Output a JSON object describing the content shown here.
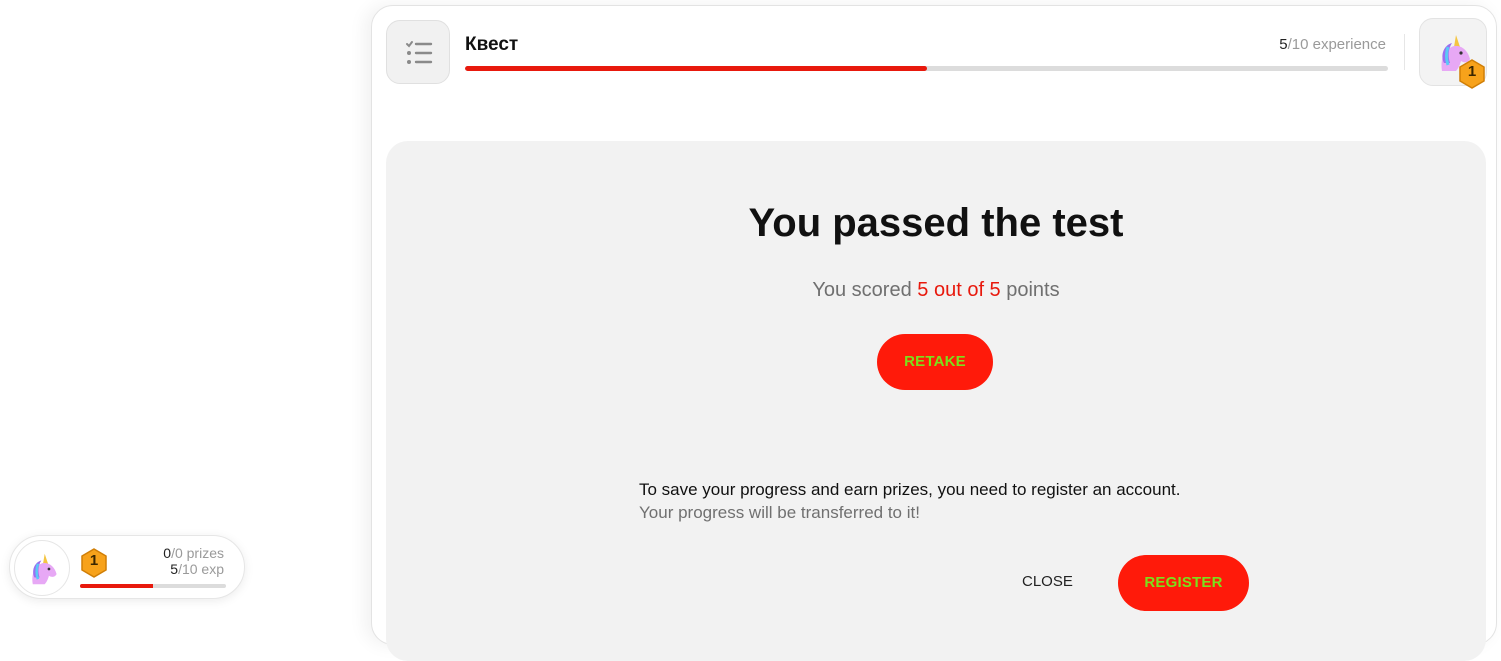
{
  "quest": {
    "title": "Квест",
    "exp_current": "5",
    "exp_total": "/10 experience",
    "progress_fraction": 0.5,
    "level": "1"
  },
  "result": {
    "title": "You passed the test",
    "score_prefix": "You scored ",
    "score_value": "5 out of 5",
    "score_suffix": " points",
    "retake_label": "RETAKE"
  },
  "register_prompt": {
    "message": "To save your progress and earn prizes, you need to register an account.",
    "sub": "Your progress will be transferred to it!",
    "close_label": "CLOSE",
    "register_label": "REGISTER"
  },
  "mini_widget": {
    "level": "1",
    "prizes_current": "0",
    "prizes_total": "/0 prizes",
    "exp_current": "5",
    "exp_total": "/10 exp",
    "progress_fraction": 0.5
  },
  "colors": {
    "accent_red": "#e8190d",
    "button_red": "#ff1a0a",
    "button_text_green": "#7be01c",
    "badge_orange": "#f7a21b"
  },
  "icons": {
    "menu": "checklist-icon",
    "avatar": "unicorn-icon",
    "level": "hexagon-badge-icon"
  }
}
